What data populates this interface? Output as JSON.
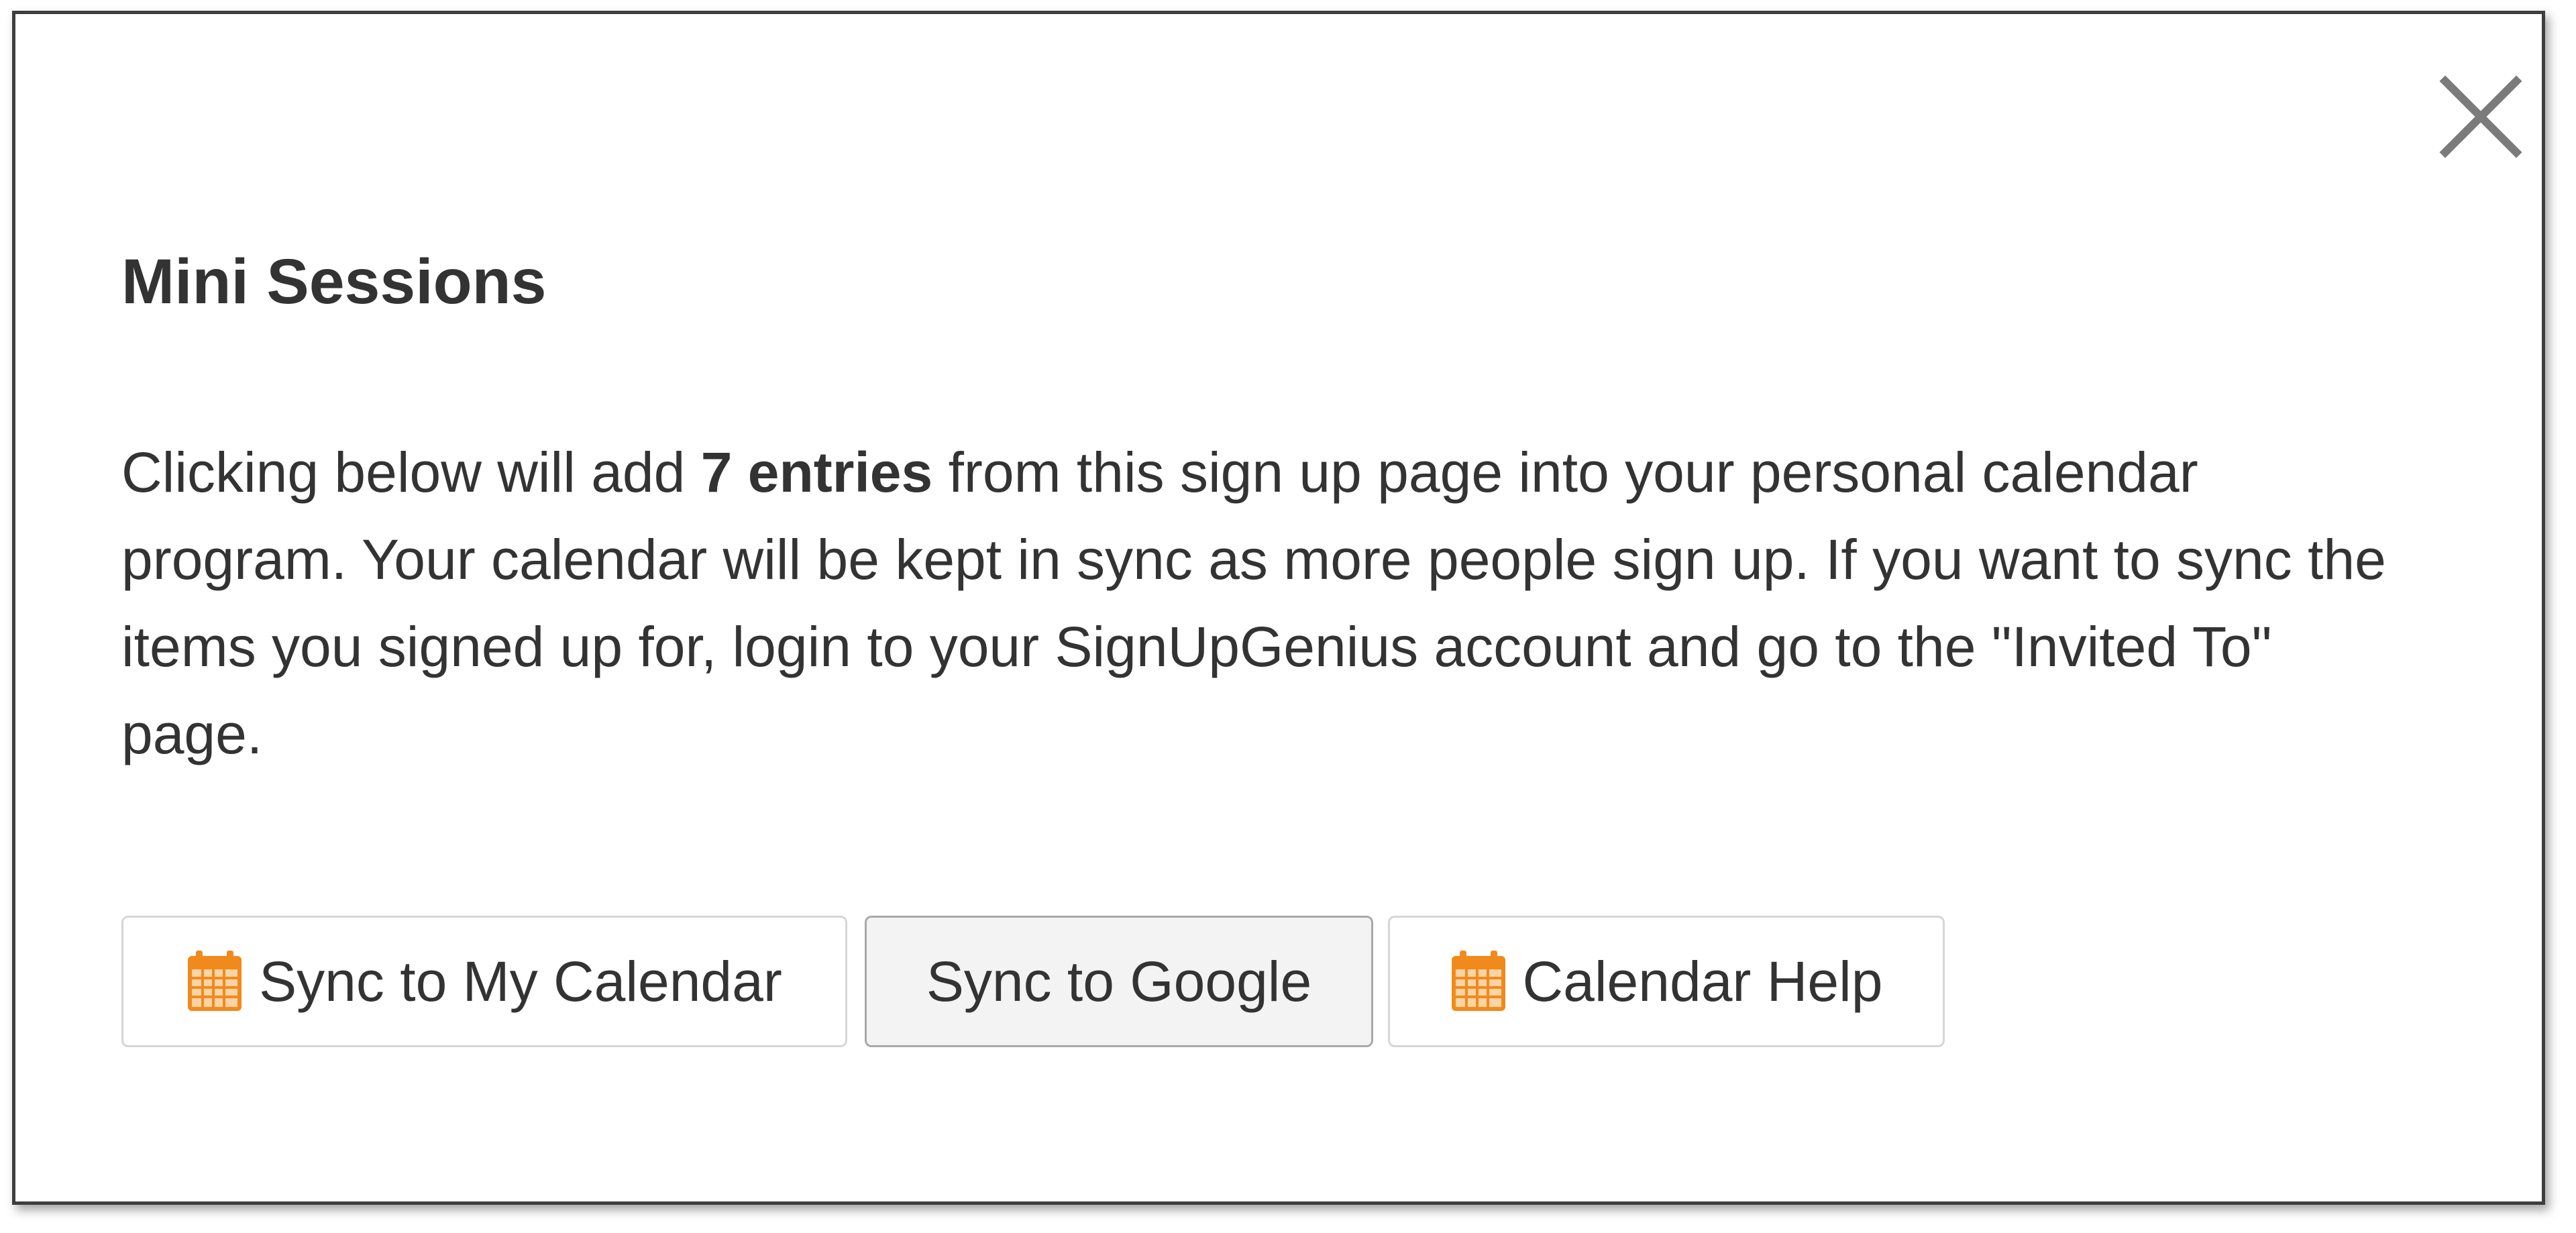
{
  "dialog": {
    "title": "Mini Sessions",
    "body_before": "Clicking below will add ",
    "body_bold": "7 entries",
    "body_after": " from this sign up page into your personal calendar program. Your calendar will be kept in sync as more people sign up. If you want to sync the items you signed up for, login to your SignUpGenius account and go to the \"Invited To\" page.",
    "close_icon": "close-icon"
  },
  "buttons": {
    "sync_calendar": {
      "label": "Sync to My Calendar",
      "icon": "calendar-icon"
    },
    "sync_google": {
      "label": "Sync to Google"
    },
    "calendar_help": {
      "label": "Calendar Help",
      "icon": "calendar-icon"
    }
  },
  "colors": {
    "accent_orange": "#f08a1c",
    "text": "#333333",
    "border": "#3e3e3e"
  }
}
